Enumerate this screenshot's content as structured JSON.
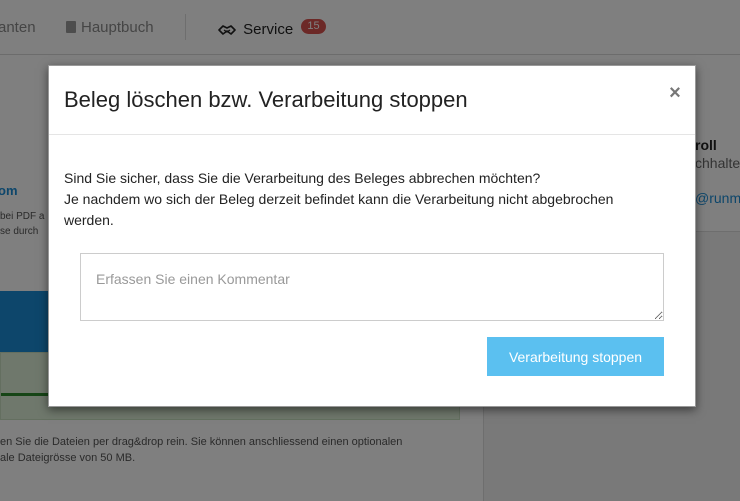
{
  "nav": {
    "items": [
      {
        "label": "anten",
        "icon": "none"
      },
      {
        "label": "Hauptbuch",
        "icon": "book-icon"
      },
      {
        "label": "Service",
        "icon": "handshake-icon",
        "badge": "15"
      }
    ]
  },
  "background": {
    "link_text": "om",
    "small_lines": [
      "bei PDF a",
      "se durch"
    ],
    "hint_lines": [
      "en Sie die Dateien per drag&drop rein. Sie können anschliessend einen optionalen",
      "ale Dateigrösse von 50 MB."
    ],
    "contact": {
      "name": "roll",
      "role": "chhalter",
      "email": "@runmy"
    }
  },
  "modal": {
    "title": "Beleg löschen bzw. Verarbeitung stoppen",
    "close_symbol": "×",
    "message_line1": "Sind Sie sicher, dass Sie die Verarbeitung des Beleges abbrechen möchten?",
    "message_line2": "Je nachdem wo sich der Beleg derzeit befindet kann die Verarbeitung nicht abgebrochen werden.",
    "comment_placeholder": "Erfassen Sie einen Kommentar",
    "comment_value": "",
    "stop_button_label": "Verarbeitung stoppen"
  },
  "colors": {
    "accent": "#1a8dd6",
    "button": "#5bc0f0",
    "badge": "#d9534f",
    "success_bg": "#dff0d8",
    "success_bar": "#2d8a2d"
  }
}
